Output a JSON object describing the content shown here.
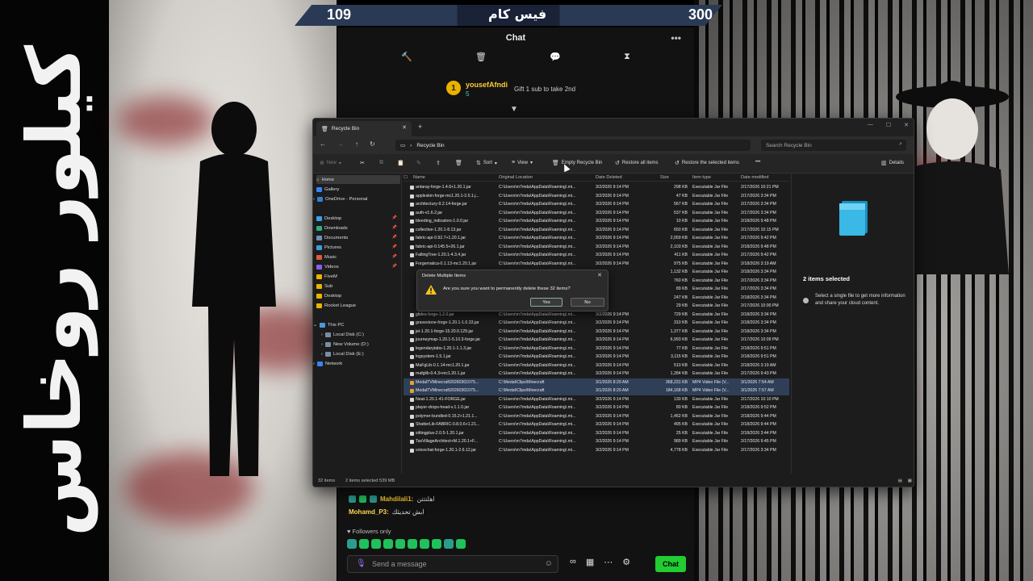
{
  "overlay": {
    "vertical_text": "كيلور روخاس",
    "top_left_number": "109",
    "top_right_number": "300",
    "top_title": "فيس كام"
  },
  "chat": {
    "title": "Chat",
    "pinned": {
      "username": "yousefAfndi",
      "count": "5",
      "gift_text": "Gift 1 sub to take 2nd",
      "badge": "1"
    },
    "messages": [
      {
        "user": "Mahdilali1:",
        "text": "اهلتتتن"
      },
      {
        "user": "Mohamd_P3:",
        "text": "ابش تحديثك"
      }
    ],
    "followers_only": "Followers only",
    "input_placeholder": "Send a message",
    "send_label": "Chat"
  },
  "explorer": {
    "tab_title": "Recycle Bin",
    "breadcrumb": "Recycle Bin",
    "search_placeholder": "Search Recycle Bin",
    "toolbar": {
      "new": "New",
      "sort": "Sort",
      "view": "View",
      "empty": "Empty Recycle Bin",
      "restore_all": "Restore all items",
      "restore_selected": "Restore the selected items",
      "details": "Details"
    },
    "nav": {
      "home": "Home",
      "gallery": "Gallery",
      "onedrive": "OneDrive - Personal",
      "desktop": "Desktop",
      "downloads": "Downloads",
      "documents": "Documents",
      "pictures": "Pictures",
      "music": "Music",
      "videos": "Videos",
      "fivem": "FiveM",
      "sub": "Sub",
      "desktop2": "Desktop",
      "rocket": "Rocket League",
      "thispc": "This PC",
      "diskc": "Local Disk (C:)",
      "diskd": "New Volume (D:)",
      "diske": "Local Disk (E:)",
      "network": "Network"
    },
    "columns": {
      "name": "Name",
      "location": "Original Location",
      "deleted": "Date Deleted",
      "size": "Size",
      "type": "Item type",
      "modified": "Date modified"
    },
    "files": [
      {
        "name": "antaray-forge-1.4.6+1.20.1.jar",
        "loc": "C:\\Users\\m7mda\\AppData\\Roaming\\.mi...",
        "deleted": "3/2/2026 9:14 PM",
        "size": "298 KB",
        "type": "Executable Jar File",
        "modified": "2/17/2026 10:21 PM",
        "mp4": false,
        "sel": false
      },
      {
        "name": "appleskin-forge-mc1.20.1-2.5.1.j...",
        "loc": "C:\\Users\\m7mda\\AppData\\Roaming\\.mi...",
        "deleted": "3/2/2026 9:14 PM",
        "size": "47 KB",
        "type": "Executable Jar File",
        "modified": "2/17/2026 3:34 PM",
        "mp4": false,
        "sel": false
      },
      {
        "name": "architectury-9.2.14-forge.jar",
        "loc": "C:\\Users\\m7mda\\AppData\\Roaming\\.mi...",
        "deleted": "3/2/2026 9:14 PM",
        "size": "567 KB",
        "type": "Executable Jar File",
        "modified": "2/17/2026 3:34 PM",
        "mp4": false,
        "sel": false
      },
      {
        "name": "auth-v1.6.2.jar",
        "loc": "C:\\Users\\m7mda\\AppData\\Roaming\\.mi...",
        "deleted": "3/2/2026 9:14 PM",
        "size": "537 KB",
        "type": "Executable Jar File",
        "modified": "2/17/2026 3:34 PM",
        "mp4": false,
        "sel": false
      },
      {
        "name": "bleeding_indicators-1.0.0.jar",
        "loc": "C:\\Users\\m7mda\\AppData\\Roaming\\.mi...",
        "deleted": "3/2/2026 9:14 PM",
        "size": "10 KB",
        "type": "Executable Jar File",
        "modified": "2/18/2026 9:48 PM",
        "mp4": false,
        "sel": false
      },
      {
        "name": "collective-1.20.1-8.13.jar",
        "loc": "C:\\Users\\m7mda\\AppData\\Roaming\\.mi...",
        "deleted": "3/2/2026 9:14 PM",
        "size": "650 KB",
        "type": "Executable Jar File",
        "modified": "2/17/2026 10:15 PM",
        "mp4": false,
        "sel": false
      },
      {
        "name": "fabric-api-0.92.7+1.20.1.jar",
        "loc": "C:\\Users\\m7mda\\AppData\\Roaming\\.mi...",
        "deleted": "3/2/2026 9:14 PM",
        "size": "2,059 KB",
        "type": "Executable Jar File",
        "modified": "2/17/2026 9:42 PM",
        "mp4": false,
        "sel": false
      },
      {
        "name": "fabric-api-0.145.5+26.1.jar",
        "loc": "C:\\Users\\m7mda\\AppData\\Roaming\\.mi...",
        "deleted": "3/2/2026 9:14 PM",
        "size": "2,103 KB",
        "type": "Executable Jar File",
        "modified": "2/18/2026 9:48 PM",
        "mp4": false,
        "sel": false
      },
      {
        "name": "FallingTree-1.20.1-4.3.4.jar",
        "loc": "C:\\Users\\m7mda\\AppData\\Roaming\\.mi...",
        "deleted": "3/2/2026 9:14 PM",
        "size": "411 KB",
        "type": "Executable Jar File",
        "modified": "2/17/2026 9:42 PM",
        "mp4": false,
        "sel": false
      },
      {
        "name": "Forgematica-0.1.13-mc1.20.1.jar",
        "loc": "C:\\Users\\m7mda\\AppData\\Roaming\\.mi...",
        "deleted": "3/2/2026 9:14 PM",
        "size": "975 KB",
        "type": "Executable Jar File",
        "modified": "2/18/2026 3:19 AM",
        "mp4": false,
        "sel": false
      },
      {
        "name": "",
        "loc": "",
        "deleted": "",
        "size": "1,132 KB",
        "type": "Executable Jar File",
        "modified": "2/18/2026 3:34 PM",
        "mp4": false,
        "sel": false
      },
      {
        "name": "",
        "loc": "",
        "deleted": "",
        "size": "760 KB",
        "type": "Executable Jar File",
        "modified": "2/17/2026 3:34 PM",
        "mp4": false,
        "sel": false
      },
      {
        "name": "",
        "loc": "",
        "deleted": "",
        "size": "89 KB",
        "type": "Executable Jar File",
        "modified": "2/17/2026 3:34 PM",
        "mp4": false,
        "sel": false
      },
      {
        "name": "",
        "loc": "",
        "deleted": "",
        "size": "247 KB",
        "type": "Executable Jar File",
        "modified": "2/18/2026 3:34 PM",
        "mp4": false,
        "sel": false
      },
      {
        "name": "",
        "loc": "",
        "deleted": "",
        "size": "29 KB",
        "type": "Executable Jar File",
        "modified": "2/17/2026 10:00 PM",
        "mp4": false,
        "sel": false
      },
      {
        "name": "glides-forge-1.2.0.jar",
        "loc": "C:\\Users\\m7mda\\AppData\\Roaming\\.mi...",
        "deleted": "3/2/2026 9:14 PM",
        "size": "729 KB",
        "type": "Executable Jar File",
        "modified": "2/18/2026 3:34 PM",
        "mp4": false,
        "sel": false
      },
      {
        "name": "gravestone-forge-1.20.1-1.0.33.jar",
        "loc": "C:\\Users\\m7mda\\AppData\\Roaming\\.mi...",
        "deleted": "3/2/2026 9:14 PM",
        "size": "310 KB",
        "type": "Executable Jar File",
        "modified": "2/18/2026 3:34 PM",
        "mp4": false,
        "sel": false
      },
      {
        "name": "jei-1.20.1-forge-15.20.0.129.jar",
        "loc": "C:\\Users\\m7mda\\AppData\\Roaming\\.mi...",
        "deleted": "3/2/2026 9:14 PM",
        "size": "1,377 KB",
        "type": "Executable Jar File",
        "modified": "2/18/2026 3:34 PM",
        "mp4": false,
        "sel": false
      },
      {
        "name": "journeymap-1.20.1-5.10.3-forge.jar",
        "loc": "C:\\Users\\m7mda\\AppData\\Roaming\\.mi...",
        "deleted": "3/2/2026 9:14 PM",
        "size": "6,993 KB",
        "type": "Executable Jar File",
        "modified": "2/17/2026 10:09 PM",
        "mp4": false,
        "sel": false
      },
      {
        "name": "legendarytabs-1.20.1-1.1.3.jar",
        "loc": "C:\\Users\\m7mda\\AppData\\Roaming\\.mi...",
        "deleted": "3/2/2026 9:14 PM",
        "size": "77 KB",
        "type": "Executable Jar File",
        "modified": "2/18/2026 9:51 PM",
        "mp4": false,
        "sel": false
      },
      {
        "name": "logsystem-1.5.1.jar",
        "loc": "C:\\Users\\m7mda\\AppData\\Roaming\\.mi...",
        "deleted": "3/2/2026 9:14 PM",
        "size": "3,115 KB",
        "type": "Executable Jar File",
        "modified": "2/18/2026 9:51 PM",
        "mp4": false,
        "sel": false
      },
      {
        "name": "MaFgLib-0.1.14-mc1.20.1.jar",
        "loc": "C:\\Users\\m7mda\\AppData\\Roaming\\.mi...",
        "deleted": "3/2/2026 9:14 PM",
        "size": "510 KB",
        "type": "Executable Jar File",
        "modified": "2/18/2026 3:19 AM",
        "mp4": false,
        "sel": false
      },
      {
        "name": "mafglib-0.4.3+mc1.20.1.jar",
        "loc": "C:\\Users\\m7mda\\AppData\\Roaming\\.mi...",
        "deleted": "3/2/2026 9:14 PM",
        "size": "1,284 KB",
        "type": "Executable Jar File",
        "modified": "2/17/2026 9:43 PM",
        "mp4": false,
        "sel": false
      },
      {
        "name": "MedalTVMinecraft20260301075...",
        "loc": "C:\\Medal\\Clips\\Minecraft",
        "deleted": "3/1/2026 8:20 AM",
        "size": "368,231 KB",
        "type": "MP4 Video File (V...",
        "modified": "3/1/2026 7:54 AM",
        "mp4": true,
        "sel": true
      },
      {
        "name": "MedalTVMinecraft20260301075...",
        "loc": "C:\\Medal\\Clips\\Minecraft",
        "deleted": "3/1/2026 8:20 AM",
        "size": "184,168 KB",
        "type": "MP4 Video File (V...",
        "modified": "3/1/2026 7:57 AM",
        "mp4": true,
        "sel": true
      },
      {
        "name": "Neat-1.20.1-41-FORGE.jar",
        "loc": "C:\\Users\\m7mda\\AppData\\Roaming\\.mi...",
        "deleted": "3/2/2026 9:14 PM",
        "size": "130 KB",
        "type": "Executable Jar File",
        "modified": "2/17/2026 10:10 PM",
        "mp4": false,
        "sel": false
      },
      {
        "name": "player-drops-head-v.1.1.0.jar",
        "loc": "C:\\Users\\m7mda\\AppData\\Roaming\\.mi...",
        "deleted": "3/2/2026 9:14 PM",
        "size": "80 KB",
        "type": "Executable Jar File",
        "modified": "2/18/2026 9:52 PM",
        "mp4": false,
        "sel": false
      },
      {
        "name": "polymer-bundled-0.15.2+1.21.1...",
        "loc": "C:\\Users\\m7mda\\AppData\\Roaming\\.mi...",
        "deleted": "3/2/2026 9:14 PM",
        "size": "1,452 KB",
        "type": "Executable Jar File",
        "modified": "2/18/2026 9:44 PM",
        "mp4": false,
        "sel": false
      },
      {
        "name": "ShatterLib-FABRIC-0.8.0.6+1.21...",
        "loc": "C:\\Users\\m7mda\\AppData\\Roaming\\.mi...",
        "deleted": "3/2/2026 9:14 PM",
        "size": "495 KB",
        "type": "Executable Jar File",
        "modified": "2/18/2026 9:44 PM",
        "mp4": false,
        "sel": false
      },
      {
        "name": "sittingplus-2.0.5-1.20.1.jar",
        "loc": "C:\\Users\\m7mda\\AppData\\Roaming\\.mi...",
        "deleted": "3/2/2026 9:14 PM",
        "size": "25 KB",
        "type": "Executable Jar File",
        "modified": "2/18/2026 3:44 PM",
        "mp4": false,
        "sel": false
      },
      {
        "name": "TaxVillageArchitect+M.1.20.1+F...",
        "loc": "C:\\Users\\m7mda\\AppData\\Roaming\\.mi...",
        "deleted": "3/2/2026 9:14 PM",
        "size": "989 KB",
        "type": "Executable Jar File",
        "modified": "2/17/2026 9:45 PM",
        "mp4": false,
        "sel": false
      },
      {
        "name": "voicechat-forge-1.20.1-2.6.12.jar",
        "loc": "C:\\Users\\m7mda\\AppData\\Roaming\\.mi...",
        "deleted": "3/2/2026 9:14 PM",
        "size": "4,778 KB",
        "type": "Executable Jar File",
        "modified": "2/17/2026 3:34 PM",
        "mp4": false,
        "sel": false
      }
    ],
    "details_pane": {
      "title": "2 items selected",
      "info": "Select a single file to get more information and share your cloud content."
    },
    "status": {
      "count": "32 items",
      "selection": "2 items selected  539 MB"
    },
    "dialog": {
      "title": "Delete Multiple Items",
      "message": "Are you sure you want to permanently delete these 32 items?",
      "yes": "Yes",
      "no": "No"
    }
  },
  "colors": {
    "accent_green": "#22cc33",
    "selection": "#2f3f58",
    "username_gold": "#ffcc33"
  }
}
